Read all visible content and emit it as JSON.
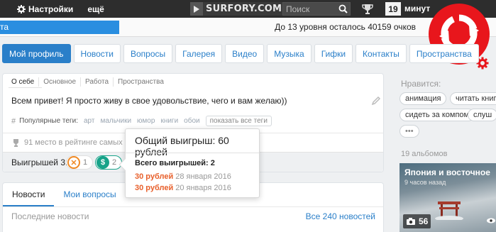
{
  "topbar": {
    "settings_label": "Настройки",
    "more_label": "ещё",
    "logo_text": "SURFORY.COM",
    "search_placeholder": "Поиск",
    "minutes_value": "19",
    "minutes_label": "минут"
  },
  "level": {
    "progress_label": "та",
    "progress_fraction": 0.24,
    "remaining_text": "До 13 уровня осталось 40159 очков"
  },
  "nav": {
    "tabs": [
      {
        "label": "Мой профиль"
      },
      {
        "label": "Новости"
      },
      {
        "label": "Вопросы"
      },
      {
        "label": "Галерея"
      },
      {
        "label": "Видео"
      },
      {
        "label": "Музыка"
      },
      {
        "label": "Гифки"
      },
      {
        "label": "Контакты"
      },
      {
        "label": "Пространства"
      }
    ]
  },
  "about": {
    "subtabs": [
      "О себе",
      "Основное",
      "Работа",
      "Пространства"
    ],
    "text": "Всем привет! Я просто живу в свое удовольствие, чего и вам желаю))",
    "tags_label": "Популярные теги:",
    "tags": [
      "арт",
      "мальчики",
      "юмор",
      "книги",
      "обои"
    ],
    "tags_all": "показать все теги",
    "rank_text": "91 место в рейтинге самых к"
  },
  "wins": {
    "label": "Выигрышей 3:",
    "badges": [
      {
        "symbol": "✕",
        "count": "1",
        "color": "#f08a25"
      },
      {
        "symbol": "$",
        "count": "2",
        "color": "#17a389"
      }
    ]
  },
  "tooltip": {
    "title": "Общий выигрыш: 60 рублей",
    "total": "Всего выигрышей: 2",
    "rows": [
      {
        "amount": "30 рублей",
        "date": "28 января 2016"
      },
      {
        "amount": "30 рублей",
        "date": "20 января 2016"
      }
    ]
  },
  "news": {
    "tabs": [
      "Новости",
      "Мои вопросы"
    ],
    "last_label": "Последние новости",
    "all_link": "Все 240 новостей"
  },
  "likes": {
    "title": "Нравится:",
    "chips": [
      "анимация",
      "читать книги",
      "сидеть за компом",
      "слуш"
    ],
    "more_chip": "•••"
  },
  "albums": {
    "title": "19 альбомов",
    "album_title": "Япония и восточное",
    "album_time": "9 часов назад",
    "album_count": "56"
  },
  "colors": {
    "accent": "#2a7fc9",
    "topbar": "#2d2d2d",
    "refresh": "#e8161c",
    "prize": "#e8602c"
  }
}
